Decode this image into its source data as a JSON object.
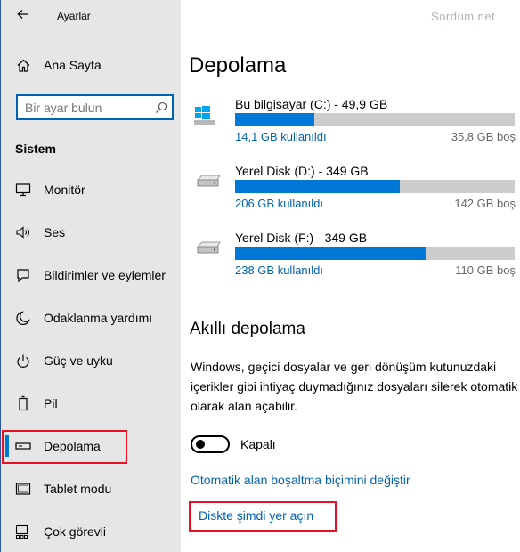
{
  "window": {
    "title": "Ayarlar"
  },
  "watermark": "Sordum.net",
  "sidebar": {
    "home_label": "Ana Sayfa",
    "search": {
      "placeholder": "Bir ayar bulun",
      "value": ""
    },
    "section_title": "Sistem",
    "items": [
      {
        "label": "Monitör",
        "icon": "monitor-icon"
      },
      {
        "label": "Ses",
        "icon": "speaker-icon"
      },
      {
        "label": "Bildirimler ve eylemler",
        "icon": "notification-icon"
      },
      {
        "label": "Odaklanma yardımı",
        "icon": "moon-icon"
      },
      {
        "label": "Güç ve uyku",
        "icon": "power-icon"
      },
      {
        "label": "Pil",
        "icon": "battery-icon"
      },
      {
        "label": "Depolama",
        "icon": "storage-icon",
        "selected": true
      },
      {
        "label": "Tablet modu",
        "icon": "tablet-icon"
      },
      {
        "label": "Çok görevli",
        "icon": "multitask-icon"
      }
    ]
  },
  "main": {
    "title": "Depolama",
    "drives": [
      {
        "name": "Bu bilgisayar (C:) - 49,9 GB",
        "used": "14,1 GB kullanıldı",
        "free": "35,8 GB boş",
        "used_fraction": 0.2826,
        "icon": "windows-drive-icon"
      },
      {
        "name": "Yerel Disk (D:) - 349 GB",
        "used": "206 GB kullanıldı",
        "free": "142 GB boş",
        "used_fraction": 0.5903,
        "icon": "hard-drive-icon"
      },
      {
        "name": "Yerel Disk (F:) - 349 GB",
        "used": "238 GB kullanıldı",
        "free": "110 GB boş",
        "used_fraction": 0.682,
        "icon": "hard-drive-icon"
      }
    ],
    "smart_storage": {
      "title": "Akıllı depolama",
      "description": "Windows, geçici dosyalar ve geri dönüşüm kutunuzdaki içerikler gibi ihtiyaç duymadığınız dosyaları silerek otomatik olarak alan  açabilir.",
      "toggle_label": "Kapalı",
      "toggle_on": false,
      "link_change": "Otomatik alan boşaltma biçimini değiştir",
      "link_free_now": "Diskte şimdi yer açın"
    }
  },
  "colors": {
    "accent": "#0078d7",
    "link": "#0063b1",
    "highlight": "#e81123",
    "sidebar_bg": "#e6e6e6",
    "bar_track": "#cccccc"
  }
}
